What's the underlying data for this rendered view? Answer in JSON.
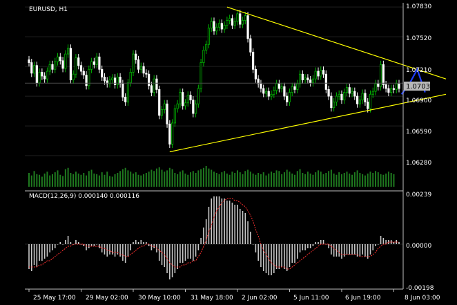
{
  "chart_data": [
    {
      "type": "candlestick",
      "symbol_label": "EURUSD, H1",
      "price_axis_labels": [
        "1.07830",
        "1.07520",
        "1.07210",
        "1.06900",
        "1.06590",
        "1.06280"
      ],
      "current_price_label": "1.07036",
      "ylim": [
        1.061,
        1.0786
      ],
      "x_tick_labels": [
        "25 May 17:00",
        "29 May 02:00",
        "30 May 10:00",
        "31 May 18:00",
        "2 Jun 02:00",
        "5 Jun 11:00",
        "6 Jun 19:00",
        "8 Jun 03:00"
      ],
      "trendlines": [
        {
          "color": "#ffff00",
          "from": {
            "bar": 76,
            "price": 1.0783
          },
          "to": {
            "bar": 160,
            "price": 1.0708
          }
        },
        {
          "color": "#ffff00",
          "from": {
            "bar": 54,
            "price": 1.0632
          },
          "to": {
            "bar": 160,
            "price": 1.0692
          }
        }
      ],
      "forecast_path": {
        "color": "#1f3fff",
        "points": [
          [
            143,
            1.0692
          ],
          [
            146,
            1.0703
          ],
          [
            149,
            1.0718
          ],
          [
            152,
            1.0694
          ]
        ]
      },
      "closes": [
        1.0725,
        1.0714,
        1.0722,
        1.0704,
        1.0715,
        1.0711,
        1.0708,
        1.0716,
        1.0723,
        1.0718,
        1.0726,
        1.0731,
        1.0727,
        1.0719,
        1.0734,
        1.074,
        1.0707,
        1.0713,
        1.073,
        1.0722,
        1.0716,
        1.0712,
        1.0701,
        1.0718,
        1.0726,
        1.0723,
        1.0731,
        1.0718,
        1.071,
        1.0706,
        1.0703,
        1.0707,
        1.0709,
        1.0702,
        1.071,
        1.0703,
        1.0689,
        1.0684,
        1.0704,
        1.0715,
        1.0734,
        1.0728,
        1.0718,
        1.0721,
        1.0714,
        1.0713,
        1.0701,
        1.0694,
        1.0708,
        1.0697,
        1.067,
        1.0676,
        1.0682,
        1.0661,
        1.064,
        1.0662,
        1.0677,
        1.0682,
        1.0694,
        1.068,
        1.0683,
        1.0691,
        1.0686,
        1.0672,
        1.0682,
        1.0698,
        1.0725,
        1.0738,
        1.0744,
        1.0761,
        1.0768,
        1.0758,
        1.0762,
        1.0766,
        1.076,
        1.0764,
        1.0769,
        1.0771,
        1.0764,
        1.0768,
        1.0776,
        1.0765,
        1.0769,
        1.0774,
        1.075,
        1.0736,
        1.0718,
        1.0708,
        1.0703,
        1.0698,
        1.0693,
        1.0695,
        1.069,
        1.0692,
        1.0696,
        1.0703,
        1.0698,
        1.07,
        1.069,
        1.0684,
        1.0694,
        1.07,
        1.0697,
        1.0703,
        1.0713,
        1.0707,
        1.0709,
        1.0707,
        1.0704,
        1.0708,
        1.0716,
        1.0711,
        1.0717,
        1.0713,
        1.0697,
        1.069,
        1.0678,
        1.0684,
        1.069,
        1.0692,
        1.0686,
        1.0694,
        1.0699,
        1.0693,
        1.0695,
        1.069,
        1.0682,
        1.0686,
        1.0693,
        1.0684,
        1.0677,
        1.0692,
        1.0695,
        1.0703,
        1.07,
        1.0723,
        1.0702,
        1.0698,
        1.0694,
        1.0698,
        1.0697,
        1.0703,
        1.0698
      ],
      "volume": [
        22,
        18,
        25,
        20,
        19,
        16,
        21,
        24,
        18,
        20,
        23,
        26,
        19,
        17,
        28,
        30,
        22,
        20,
        24,
        21,
        19,
        22,
        18,
        25,
        27,
        21,
        20,
        18,
        23,
        19,
        24,
        17,
        16,
        20,
        22,
        25,
        28,
        30,
        26,
        24,
        21,
        23,
        19,
        18,
        20,
        22,
        24,
        27,
        25,
        29,
        31,
        27,
        24,
        26,
        30,
        28,
        22,
        20,
        24,
        26,
        21,
        19,
        23,
        25,
        22,
        26,
        28,
        30,
        33,
        29,
        27,
        24,
        22,
        20,
        23,
        25,
        21,
        19,
        24,
        22,
        26,
        23,
        20,
        25,
        27,
        24,
        21,
        19,
        22,
        20,
        23,
        18,
        21,
        24,
        22,
        26,
        25,
        20,
        23,
        27,
        24,
        21,
        19,
        25,
        28,
        22,
        20,
        24,
        21,
        19,
        23,
        26,
        24,
        20,
        22,
        25,
        27,
        21,
        19,
        23,
        20,
        22,
        24,
        21,
        19,
        23,
        26,
        22,
        20,
        18,
        21,
        24,
        22,
        25,
        23,
        20,
        19,
        21,
        24,
        22,
        20
      ],
      "macd": {
        "label": "MACD(12,26,9) 0.000140 0.000116",
        "axis_labels": [
          "0.00239",
          "0.00000",
          "-0.00198"
        ],
        "ylim": [
          -0.0021,
          0.0025
        ],
        "histogram": [
          -0.0012,
          -0.0013,
          -0.001,
          -0.0011,
          -0.0008,
          -0.0008,
          -0.0007,
          -0.0006,
          -0.0004,
          -0.0003,
          -0.0002,
          0.0,
          0.0001,
          0.0,
          0.0002,
          0.0004,
          0.0001,
          0.0,
          0.0002,
          0.0001,
          0.0,
          -0.0001,
          -0.0003,
          -0.0002,
          -0.0001,
          -0.0001,
          0.0,
          -0.0002,
          -0.0004,
          -0.0005,
          -0.0006,
          -0.0005,
          -0.0005,
          -0.0006,
          -0.0005,
          -0.0006,
          -0.0008,
          -0.0009,
          -0.0006,
          -0.0003,
          0.0001,
          0.0002,
          0.0001,
          0.0002,
          0.0001,
          0.0001,
          -0.0001,
          -0.0003,
          -0.0002,
          -0.0004,
          -0.0008,
          -0.001,
          -0.0011,
          -0.0014,
          -0.0017,
          -0.0016,
          -0.0014,
          -0.0012,
          -0.0009,
          -0.0009,
          -0.0008,
          -0.0007,
          -0.0007,
          -0.0008,
          -0.0006,
          -0.0003,
          0.0003,
          0.0008,
          0.0012,
          0.0018,
          0.0022,
          0.0023,
          0.0023,
          0.0023,
          0.0022,
          0.0022,
          0.0021,
          0.0021,
          0.002,
          0.0019,
          0.0019,
          0.0017,
          0.0016,
          0.0015,
          0.0011,
          0.0006,
          0.0,
          -0.0004,
          -0.0008,
          -0.0011,
          -0.0013,
          -0.0014,
          -0.0015,
          -0.0015,
          -0.0014,
          -0.0012,
          -0.0012,
          -0.0011,
          -0.0012,
          -0.0013,
          -0.0011,
          -0.0009,
          -0.0009,
          -0.0007,
          -0.0004,
          -0.0003,
          -0.0003,
          -0.0002,
          -0.0002,
          -0.0001,
          0.0001,
          0.0001,
          0.0002,
          0.0002,
          0.0,
          -0.0002,
          -0.0005,
          -0.0006,
          -0.0006,
          -0.0006,
          -0.0007,
          -0.0006,
          -0.0005,
          -0.0005,
          -0.0005,
          -0.0005,
          -0.0006,
          -0.0006,
          -0.0005,
          -0.0006,
          -0.0007,
          -0.0005,
          -0.0003,
          -0.0001,
          0.0,
          0.0004,
          0.0003,
          0.0002,
          0.0002,
          0.0002,
          0.0001,
          0.0002,
          0.0001
        ],
        "signal": [
          -0.0011,
          -0.0011,
          -0.0011,
          -0.0011,
          -0.001,
          -0.001,
          -0.0009,
          -0.0008,
          -0.0008,
          -0.0007,
          -0.0006,
          -0.0005,
          -0.0004,
          -0.0003,
          -0.0002,
          -0.0001,
          -0.0001,
          0.0,
          0.0,
          0.0,
          0.0,
          0.0,
          -0.0001,
          -0.0001,
          -0.0001,
          -0.0001,
          -0.0001,
          -0.0001,
          -0.0002,
          -0.0002,
          -0.0003,
          -0.0003,
          -0.0004,
          -0.0004,
          -0.0004,
          -0.0005,
          -0.0005,
          -0.0006,
          -0.0006,
          -0.0005,
          -0.0004,
          -0.0003,
          -0.0002,
          -0.0001,
          -0.0001,
          0.0,
          0.0,
          -0.0001,
          -0.0001,
          -0.0002,
          -0.0003,
          -0.0004,
          -0.0005,
          -0.0007,
          -0.0009,
          -0.001,
          -0.0011,
          -0.0011,
          -0.0011,
          -0.001,
          -0.001,
          -0.0009,
          -0.0009,
          -0.0008,
          -0.0008,
          -0.0006,
          -0.0004,
          -0.0001,
          0.0002,
          0.0006,
          0.0009,
          0.0013,
          0.0016,
          0.0018,
          0.002,
          0.0021,
          0.0022,
          0.0022,
          0.0022,
          0.0021,
          0.0021,
          0.002,
          0.0019,
          0.0018,
          0.0016,
          0.0014,
          0.0011,
          0.0007,
          0.0004,
          0.0,
          -0.0003,
          -0.0005,
          -0.0007,
          -0.0009,
          -0.001,
          -0.0011,
          -0.0011,
          -0.0011,
          -0.0011,
          -0.0012,
          -0.0012,
          -0.0011,
          -0.001,
          -0.0009,
          -0.0008,
          -0.0007,
          -0.0006,
          -0.0005,
          -0.0004,
          -0.0003,
          -0.0002,
          -0.0001,
          0.0,
          0.0,
          0.0,
          0.0,
          -0.0001,
          -0.0002,
          -0.0003,
          -0.0004,
          -0.0005,
          -0.0005,
          -0.0005,
          -0.0005,
          -0.0005,
          -0.0005,
          -0.0005,
          -0.0006,
          -0.0006,
          -0.0006,
          -0.0006,
          -0.0006,
          -0.0005,
          -0.0004,
          -0.0002,
          -0.0001,
          0.0,
          0.0,
          0.0001,
          0.0001,
          0.0001,
          0.0001,
          0.0001
        ]
      },
      "colors": {
        "background": "#000000",
        "bull": "#00b400",
        "bear": "#ffffff",
        "histogram": "#c8c8c8",
        "signal": "#ff3030",
        "volume": "#1f7a1f",
        "grid": "#202020",
        "axis": "#c0c0c0"
      }
    }
  ]
}
